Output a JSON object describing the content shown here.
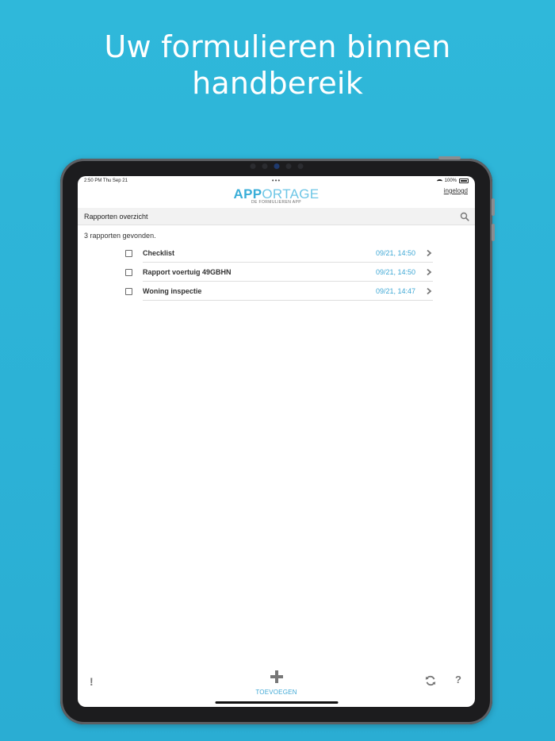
{
  "headline": {
    "line1": "Uw formulieren binnen",
    "line2": "handbereik"
  },
  "status_bar": {
    "time": "2:50 PM  Thu Sep 21",
    "dots": "•••",
    "battery": "100%"
  },
  "app": {
    "logo_bold": "APP",
    "logo_light": "ORTAGE",
    "logo_sub": "DE FORMULIEREN APP",
    "login_label": "ingelogd",
    "accent_color": "#3fa8d5"
  },
  "header": {
    "title": "Rapporten overzicht",
    "search_icon": "search-icon"
  },
  "results_text": "3 rapporten gevonden.",
  "reports": [
    {
      "name": "Checklist",
      "date": "09/21, 14:50"
    },
    {
      "name": "Rapport voertuig 49GBHN",
      "date": "09/21, 14:50"
    },
    {
      "name": "Woning inspectie",
      "date": "09/21, 14:47"
    }
  ],
  "toolbar": {
    "alert_label": "!",
    "add_label": "TOEVOEGEN",
    "refresh_icon": "refresh-icon",
    "help_label": "?"
  }
}
